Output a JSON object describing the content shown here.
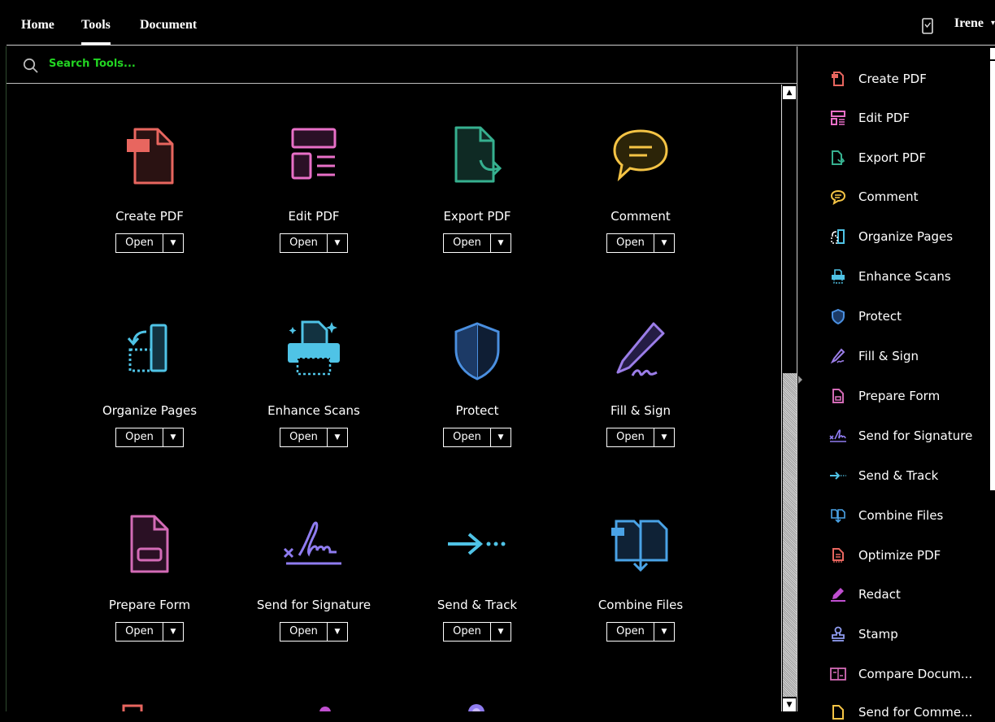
{
  "nav": {
    "tabs": [
      {
        "label": "Home"
      },
      {
        "label": "Tools"
      },
      {
        "label": "Document"
      }
    ],
    "user_name": "Irene"
  },
  "search": {
    "placeholder": "Search Tools..."
  },
  "tools": [
    {
      "label": "Create PDF",
      "button": "Open",
      "icon": "create-pdf-icon",
      "color": "#e8665f"
    },
    {
      "label": "Edit PDF",
      "button": "Open",
      "icon": "edit-pdf-icon",
      "color": "#e86fc7"
    },
    {
      "label": "Export PDF",
      "button": "Open",
      "icon": "export-pdf-icon",
      "color": "#36b08f"
    },
    {
      "label": "Comment",
      "button": "Open",
      "icon": "comment-icon",
      "color": "#f5c445"
    },
    {
      "label": "Organize Pages",
      "button": "Open",
      "icon": "organize-pages-icon",
      "color": "#4fc3e6"
    },
    {
      "label": "Enhance Scans",
      "button": "Open",
      "icon": "enhance-scans-icon",
      "color": "#4fc3e6"
    },
    {
      "label": "Protect",
      "button": "Open",
      "icon": "protect-icon",
      "color": "#4a8fe0"
    },
    {
      "label": "Fill & Sign",
      "button": "Open",
      "icon": "fill-sign-icon",
      "color": "#9b7de8"
    },
    {
      "label": "Prepare Form",
      "button": "Open",
      "icon": "prepare-form-icon",
      "color": "#d36bb6"
    },
    {
      "label": "Send for Signature",
      "button": "Open",
      "icon": "send-signature-icon",
      "color": "#8f7cf0"
    },
    {
      "label": "Send & Track",
      "button": "Open",
      "icon": "send-track-icon",
      "color": "#4fc3e6"
    },
    {
      "label": "Combine Files",
      "button": "Open",
      "icon": "combine-files-icon",
      "color": "#4aa3e6"
    }
  ],
  "sidebar": {
    "items": [
      {
        "label": "Create PDF",
        "icon": "create-pdf-icon"
      },
      {
        "label": "Edit PDF",
        "icon": "edit-pdf-icon"
      },
      {
        "label": "Export PDF",
        "icon": "export-pdf-icon"
      },
      {
        "label": "Comment",
        "icon": "comment-icon"
      },
      {
        "label": "Organize Pages",
        "icon": "organize-pages-icon"
      },
      {
        "label": "Enhance Scans",
        "icon": "enhance-scans-icon"
      },
      {
        "label": "Protect",
        "icon": "protect-icon"
      },
      {
        "label": "Fill & Sign",
        "icon": "fill-sign-icon"
      },
      {
        "label": "Prepare Form",
        "icon": "prepare-form-icon"
      },
      {
        "label": "Send for Signature",
        "icon": "send-signature-icon"
      },
      {
        "label": "Send & Track",
        "icon": "send-track-icon"
      },
      {
        "label": "Combine Files",
        "icon": "combine-files-icon"
      },
      {
        "label": "Optimize PDF",
        "icon": "optimize-pdf-icon"
      },
      {
        "label": "Redact",
        "icon": "redact-icon"
      },
      {
        "label": "Stamp",
        "icon": "stamp-icon"
      },
      {
        "label": "Compare Docum...",
        "icon": "compare-documents-icon"
      },
      {
        "label": "Send for Comme...",
        "icon": "send-comments-icon"
      }
    ]
  },
  "colors": {
    "search_text": "#22d522",
    "background": "#000000"
  }
}
